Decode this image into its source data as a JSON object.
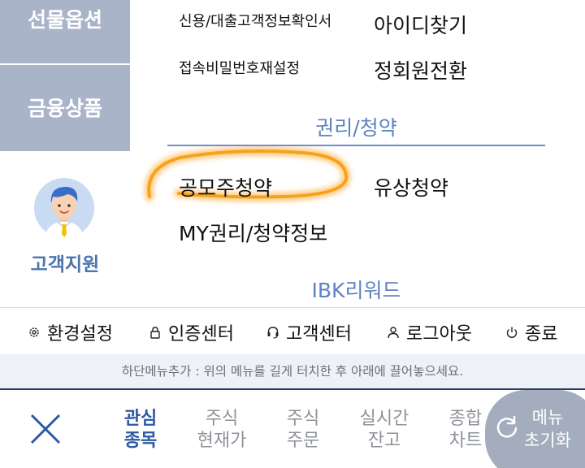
{
  "sidebar": {
    "tabs": [
      "선물옵션",
      "금융상품"
    ],
    "support_label": "고객지원"
  },
  "menu": {
    "rows_top": [
      {
        "left": "신용/대출고객정보확인서",
        "right": "아이디찾기"
      },
      {
        "left": "접속비밀번호재설정",
        "right": "정회원전환"
      }
    ],
    "rights_section": {
      "title": "권리/청약",
      "items": [
        "공모주청약",
        "유상청약",
        "MY권리/청약정보"
      ]
    },
    "reward_section": {
      "title": "IBK리워드"
    }
  },
  "utility": {
    "items": [
      {
        "label": "환경설정",
        "icon": "gear-icon"
      },
      {
        "label": "인증센터",
        "icon": "lock-icon"
      },
      {
        "label": "고객센터",
        "icon": "headset-icon"
      },
      {
        "label": "로그아웃",
        "icon": "user-icon"
      },
      {
        "label": "종료",
        "icon": "power-icon"
      }
    ]
  },
  "hint": "하단메뉴추가 : 위의 메뉴를 길게 터치한 후 아래에 끌어놓으세요.",
  "bottom_nav": {
    "items": [
      {
        "line1": "관심",
        "line2": "종목",
        "active": true
      },
      {
        "line1": "주식",
        "line2": "현재가",
        "active": false
      },
      {
        "line1": "주식",
        "line2": "주문",
        "active": false
      },
      {
        "line1": "실시간",
        "line2": "잔고",
        "active": false
      },
      {
        "line1": "종합",
        "line2": "차트",
        "active": false
      }
    ],
    "reset": {
      "line1": "메뉴",
      "line2": "초기화"
    }
  },
  "colors": {
    "sidebar_tab": "#a9b4c9",
    "accent_blue": "#5d83c2",
    "active_nav": "#2d58a6",
    "highlight": "#f7a21b"
  }
}
